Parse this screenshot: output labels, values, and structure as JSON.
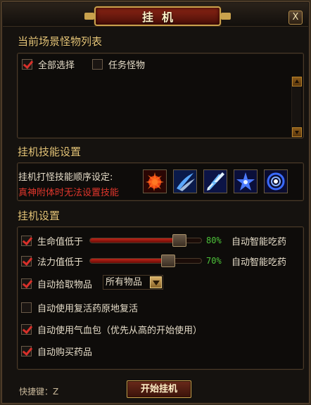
{
  "window": {
    "title": "挂机",
    "close_glyph": "X"
  },
  "monsters": {
    "section_title": "当前场景怪物列表",
    "select_all": {
      "label": "全部选择",
      "checked": true
    },
    "quest_monsters": {
      "label": "任务怪物",
      "checked": false
    }
  },
  "skills": {
    "section_title": "挂机技能设置",
    "order_label": "挂机打怪技能顺序设定:",
    "warning": "真神附体时无法设置技能",
    "icons": [
      "fire-burst-skill-icon",
      "blue-slash-skill-icon",
      "lightning-blade-skill-icon",
      "star-burst-skill-icon",
      "vortex-skill-icon"
    ]
  },
  "settings": {
    "section_title": "挂机设置",
    "hp": {
      "label": "生命值低于",
      "checked": true,
      "value": 80,
      "value_text": "80%",
      "auto_label": "自动智能吃药"
    },
    "mp": {
      "label": "法力值低于",
      "checked": true,
      "value": 70,
      "value_text": "70%",
      "auto_label": "自动智能吃药"
    },
    "pickup": {
      "label": "自动拾取物品",
      "checked": true,
      "select_value": "所有物品"
    },
    "revive": {
      "label": "自动使用复活药原地复活",
      "checked": false
    },
    "potion_pack": {
      "label": "自动使用气血包（优先从高的开始使用）",
      "checked": true
    },
    "buy_potions": {
      "label": "自动购买药品",
      "checked": true
    }
  },
  "footer": {
    "hotkey": "快捷键：Z",
    "start_button": "开始挂机"
  },
  "colors": {
    "accent_gold": "#e8c77a",
    "warning_red": "#e0362c",
    "percent_green": "#4ec43a",
    "slider_red": "#c02418"
  }
}
